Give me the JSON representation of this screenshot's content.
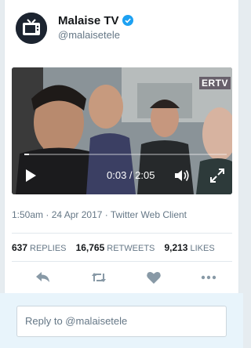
{
  "account": {
    "display_name": "Malaise TV",
    "handle": "@malaisetele",
    "verified": true,
    "avatar_icon": "tv-icon"
  },
  "video": {
    "watermark": "ERTV",
    "time_display": "0:03 / 2:05",
    "progress_fraction": 0.024
  },
  "tweet_meta": {
    "timestamp": "1:50am · 24 Apr 2017 · Twitter Web Client"
  },
  "stats": {
    "replies_count": "637",
    "replies_label": "REPLIES",
    "retweets_count": "16,765",
    "retweets_label": "RETWEETS",
    "likes_count": "9,213",
    "likes_label": "LIKES"
  },
  "actions": [
    "reply-icon",
    "retweet-icon",
    "like-icon",
    "more-icon"
  ],
  "reply": {
    "placeholder": "Reply to @malaisetele"
  },
  "colors": {
    "accent": "#1da1f2",
    "icon_gray": "#8899a6",
    "reply_area_bg": "#e8f4fb"
  }
}
